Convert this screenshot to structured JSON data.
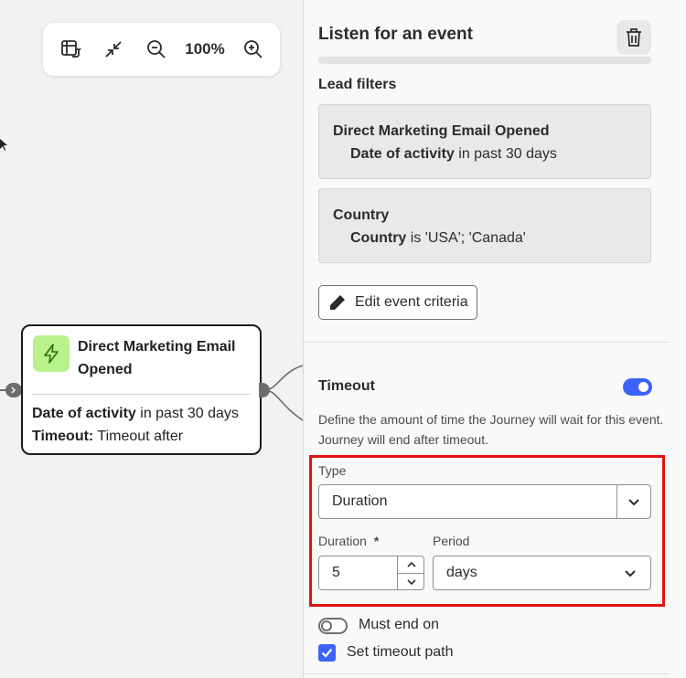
{
  "toolbar": {
    "zoom_level": "100%",
    "buttons": [
      "fit-view-icon",
      "collapse-icon",
      "zoom-out-icon",
      "zoom-in-icon"
    ]
  },
  "node": {
    "title": "Direct Marketing Email Opened",
    "line1_bold": "Date of activity",
    "line1_rest": " in past 30 days",
    "line2_bold": "Timeout:",
    "line2_rest": " Timeout after",
    "icon": "lightning-icon",
    "icon_bg": "#b8f28a"
  },
  "panel": {
    "title": "Listen for an event",
    "lead_filters_label": "Lead filters",
    "filters": [
      {
        "title": "Direct Marketing Email Opened",
        "detail_bold": "Date of activity",
        "detail_rest": " in past 30 days"
      },
      {
        "title": "Country",
        "detail_bold": "Country",
        "detail_rest": " is 'USA'; 'Canada'"
      }
    ],
    "edit_button": "Edit event criteria",
    "timeout": {
      "label": "Timeout",
      "enabled": true,
      "description": "Define the amount of time the Journey will wait for this event. Journey will end after timeout."
    },
    "type": {
      "label": "Type",
      "value": "Duration"
    },
    "duration": {
      "label": "Duration",
      "required_mark": "*",
      "value": "5"
    },
    "period": {
      "label": "Period",
      "value": "days"
    },
    "must_end_on": {
      "label": "Must end on",
      "enabled": false
    },
    "set_timeout_path": {
      "label": "Set timeout path",
      "checked": true
    }
  },
  "colors": {
    "accent": "#3b63fb",
    "highlight": "#e01414"
  }
}
